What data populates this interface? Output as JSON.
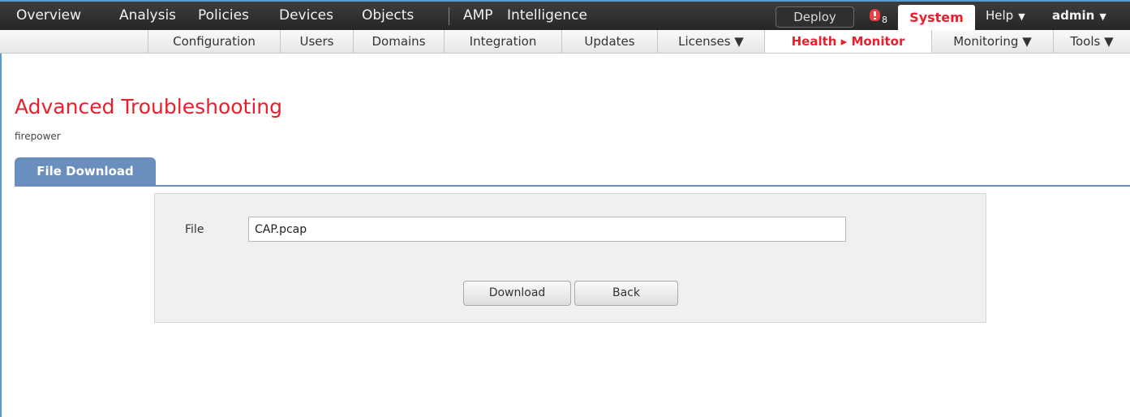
{
  "topnav": {
    "items": [
      "Overview",
      "Analysis",
      "Policies",
      "Devices",
      "Objects"
    ],
    "items2": [
      "AMP",
      "Intelligence"
    ],
    "deploy_label": "Deploy",
    "alert_count": "8",
    "system_label": "System",
    "help_label": "Help",
    "user_label": "admin",
    "caret": "▼"
  },
  "subnav": {
    "items": [
      "Configuration",
      "Users",
      "Domains",
      "Integration",
      "Updates",
      "Licenses ▼",
      "Health ▸ Monitor",
      "Monitoring ▼",
      "Tools ▼"
    ],
    "active_index": 6
  },
  "page": {
    "title": "Advanced Troubleshooting",
    "subtitle": "firepower"
  },
  "tab": {
    "label": "File Download"
  },
  "form": {
    "file_label": "File",
    "file_value": "CAP.pcap",
    "download_label": "Download",
    "back_label": "Back"
  },
  "colors": {
    "accent_red": "#e8202e",
    "tab_blue": "#6a8fbf",
    "nav_dark": "#2f2f2f"
  }
}
